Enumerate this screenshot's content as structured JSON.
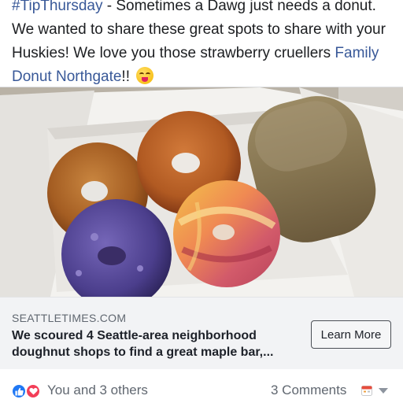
{
  "post": {
    "hashtag": "#TipThursday",
    "text_part1": " - Sometimes a Dawg just needs a donut. We wanted to share these great spots to share with your Huskies! We love you those strawberry cruellers ",
    "page_link": "Family Donut Northgate",
    "text_part2": "!!",
    "emoji": "savoring-food-face-icon"
  },
  "link_card": {
    "photo": "box-of-donuts-image",
    "domain": "SEATTLETIMES.COM",
    "title": "We scoured 4 Seattle-area neighborhood doughnut shops to find a great maple bar,...",
    "cta_label": "Learn More"
  },
  "footer": {
    "reaction_icons": [
      "like-icon",
      "love-icon"
    ],
    "reactors": "You and 3 others",
    "comments": "3 Comments"
  },
  "colors": {
    "link": "#385898",
    "like": "#2078f4",
    "love": "#f33e58",
    "caption_bg": "#f2f3f5",
    "meta_text": "#606770"
  }
}
